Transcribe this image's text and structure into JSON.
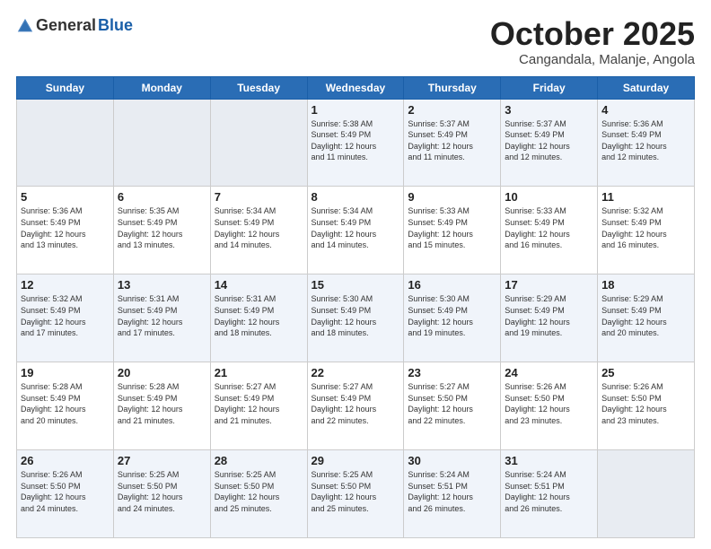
{
  "logo": {
    "general": "General",
    "blue": "Blue"
  },
  "header": {
    "month": "October 2025",
    "location": "Cangandala, Malanje, Angola"
  },
  "weekdays": [
    "Sunday",
    "Monday",
    "Tuesday",
    "Wednesday",
    "Thursday",
    "Friday",
    "Saturday"
  ],
  "weeks": [
    [
      {
        "day": "",
        "info": ""
      },
      {
        "day": "",
        "info": ""
      },
      {
        "day": "",
        "info": ""
      },
      {
        "day": "1",
        "info": "Sunrise: 5:38 AM\nSunset: 5:49 PM\nDaylight: 12 hours\nand 11 minutes."
      },
      {
        "day": "2",
        "info": "Sunrise: 5:37 AM\nSunset: 5:49 PM\nDaylight: 12 hours\nand 11 minutes."
      },
      {
        "day": "3",
        "info": "Sunrise: 5:37 AM\nSunset: 5:49 PM\nDaylight: 12 hours\nand 12 minutes."
      },
      {
        "day": "4",
        "info": "Sunrise: 5:36 AM\nSunset: 5:49 PM\nDaylight: 12 hours\nand 12 minutes."
      }
    ],
    [
      {
        "day": "5",
        "info": "Sunrise: 5:36 AM\nSunset: 5:49 PM\nDaylight: 12 hours\nand 13 minutes."
      },
      {
        "day": "6",
        "info": "Sunrise: 5:35 AM\nSunset: 5:49 PM\nDaylight: 12 hours\nand 13 minutes."
      },
      {
        "day": "7",
        "info": "Sunrise: 5:34 AM\nSunset: 5:49 PM\nDaylight: 12 hours\nand 14 minutes."
      },
      {
        "day": "8",
        "info": "Sunrise: 5:34 AM\nSunset: 5:49 PM\nDaylight: 12 hours\nand 14 minutes."
      },
      {
        "day": "9",
        "info": "Sunrise: 5:33 AM\nSunset: 5:49 PM\nDaylight: 12 hours\nand 15 minutes."
      },
      {
        "day": "10",
        "info": "Sunrise: 5:33 AM\nSunset: 5:49 PM\nDaylight: 12 hours\nand 16 minutes."
      },
      {
        "day": "11",
        "info": "Sunrise: 5:32 AM\nSunset: 5:49 PM\nDaylight: 12 hours\nand 16 minutes."
      }
    ],
    [
      {
        "day": "12",
        "info": "Sunrise: 5:32 AM\nSunset: 5:49 PM\nDaylight: 12 hours\nand 17 minutes."
      },
      {
        "day": "13",
        "info": "Sunrise: 5:31 AM\nSunset: 5:49 PM\nDaylight: 12 hours\nand 17 minutes."
      },
      {
        "day": "14",
        "info": "Sunrise: 5:31 AM\nSunset: 5:49 PM\nDaylight: 12 hours\nand 18 minutes."
      },
      {
        "day": "15",
        "info": "Sunrise: 5:30 AM\nSunset: 5:49 PM\nDaylight: 12 hours\nand 18 minutes."
      },
      {
        "day": "16",
        "info": "Sunrise: 5:30 AM\nSunset: 5:49 PM\nDaylight: 12 hours\nand 19 minutes."
      },
      {
        "day": "17",
        "info": "Sunrise: 5:29 AM\nSunset: 5:49 PM\nDaylight: 12 hours\nand 19 minutes."
      },
      {
        "day": "18",
        "info": "Sunrise: 5:29 AM\nSunset: 5:49 PM\nDaylight: 12 hours\nand 20 minutes."
      }
    ],
    [
      {
        "day": "19",
        "info": "Sunrise: 5:28 AM\nSunset: 5:49 PM\nDaylight: 12 hours\nand 20 minutes."
      },
      {
        "day": "20",
        "info": "Sunrise: 5:28 AM\nSunset: 5:49 PM\nDaylight: 12 hours\nand 21 minutes."
      },
      {
        "day": "21",
        "info": "Sunrise: 5:27 AM\nSunset: 5:49 PM\nDaylight: 12 hours\nand 21 minutes."
      },
      {
        "day": "22",
        "info": "Sunrise: 5:27 AM\nSunset: 5:49 PM\nDaylight: 12 hours\nand 22 minutes."
      },
      {
        "day": "23",
        "info": "Sunrise: 5:27 AM\nSunset: 5:50 PM\nDaylight: 12 hours\nand 22 minutes."
      },
      {
        "day": "24",
        "info": "Sunrise: 5:26 AM\nSunset: 5:50 PM\nDaylight: 12 hours\nand 23 minutes."
      },
      {
        "day": "25",
        "info": "Sunrise: 5:26 AM\nSunset: 5:50 PM\nDaylight: 12 hours\nand 23 minutes."
      }
    ],
    [
      {
        "day": "26",
        "info": "Sunrise: 5:26 AM\nSunset: 5:50 PM\nDaylight: 12 hours\nand 24 minutes."
      },
      {
        "day": "27",
        "info": "Sunrise: 5:25 AM\nSunset: 5:50 PM\nDaylight: 12 hours\nand 24 minutes."
      },
      {
        "day": "28",
        "info": "Sunrise: 5:25 AM\nSunset: 5:50 PM\nDaylight: 12 hours\nand 25 minutes."
      },
      {
        "day": "29",
        "info": "Sunrise: 5:25 AM\nSunset: 5:50 PM\nDaylight: 12 hours\nand 25 minutes."
      },
      {
        "day": "30",
        "info": "Sunrise: 5:24 AM\nSunset: 5:51 PM\nDaylight: 12 hours\nand 26 minutes."
      },
      {
        "day": "31",
        "info": "Sunrise: 5:24 AM\nSunset: 5:51 PM\nDaylight: 12 hours\nand 26 minutes."
      },
      {
        "day": "",
        "info": ""
      }
    ]
  ]
}
